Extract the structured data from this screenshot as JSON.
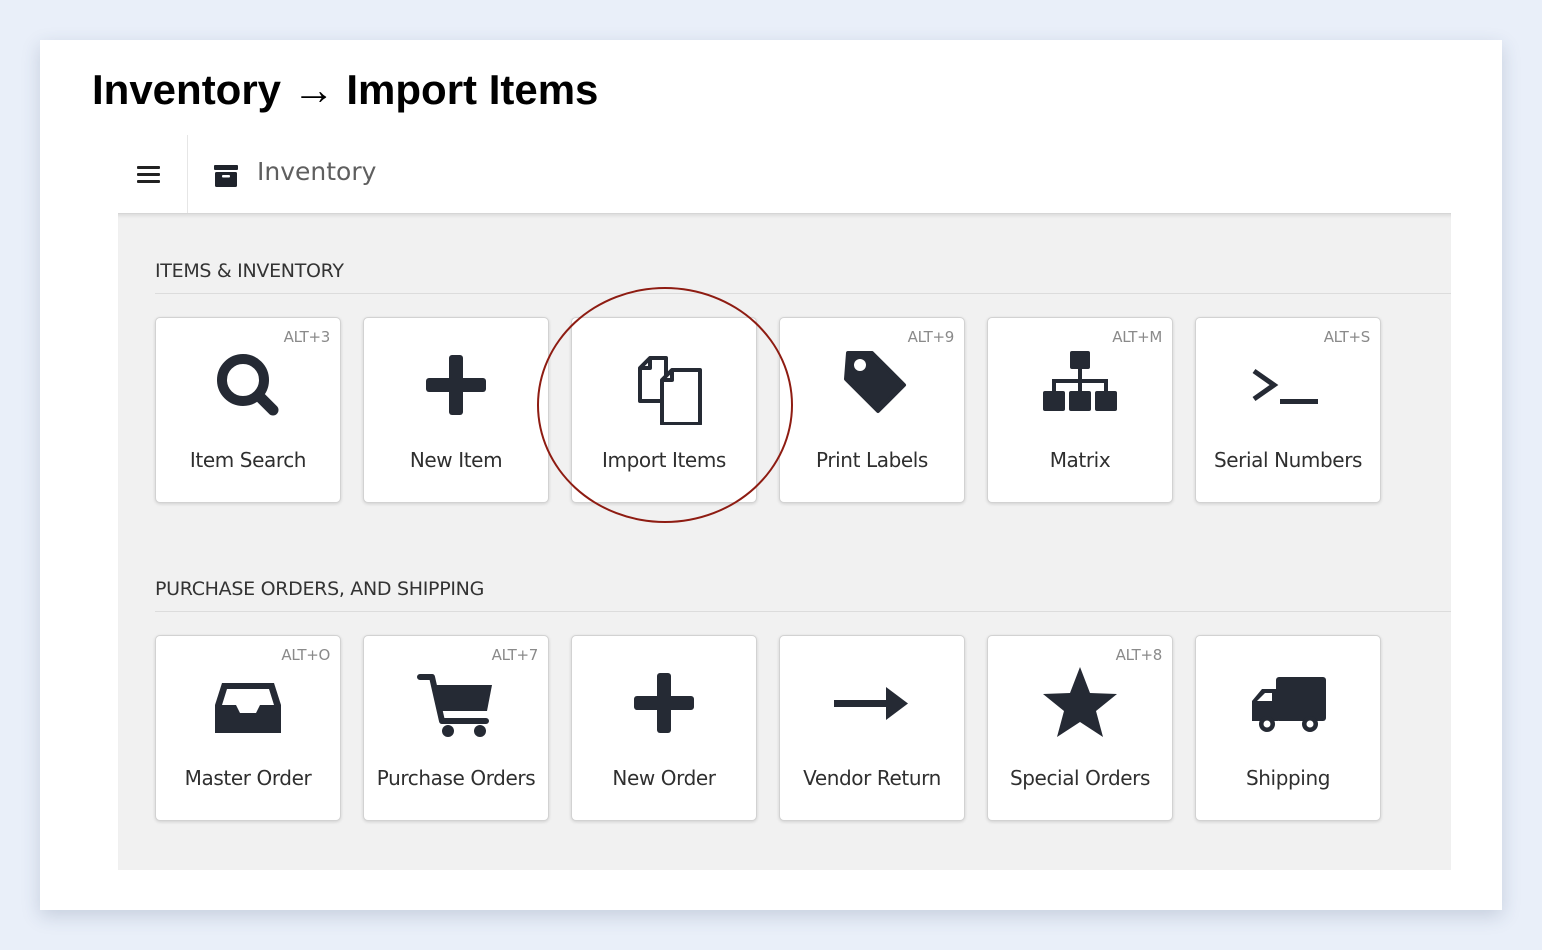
{
  "doc_title": "Inventory → Import Items",
  "app": {
    "title": "Inventory",
    "icon": "archive-icon",
    "menu_icon": "hamburger-menu-icon"
  },
  "sections": [
    {
      "title": "ITEMS & INVENTORY",
      "tiles": [
        {
          "label": "Item Search",
          "shortcut": "ALT+3",
          "icon": "search-icon"
        },
        {
          "label": "New Item",
          "shortcut": "",
          "icon": "plus-icon"
        },
        {
          "label": "Import Items",
          "shortcut": "",
          "icon": "copy-documents-icon",
          "highlighted": true
        },
        {
          "label": "Print Labels",
          "shortcut": "ALT+9",
          "icon": "tag-icon"
        },
        {
          "label": "Matrix",
          "shortcut": "ALT+M",
          "icon": "sitemap-icon"
        },
        {
          "label": "Serial Numbers",
          "shortcut": "ALT+S",
          "icon": "terminal-icon"
        }
      ]
    },
    {
      "title": "PURCHASE ORDERS, AND SHIPPING",
      "tiles": [
        {
          "label": "Master Order",
          "shortcut": "ALT+O",
          "icon": "inbox-icon"
        },
        {
          "label": "Purchase Orders",
          "shortcut": "ALT+7",
          "icon": "shopping-cart-icon"
        },
        {
          "label": "New Order",
          "shortcut": "",
          "icon": "plus-icon"
        },
        {
          "label": "Vendor Return",
          "shortcut": "",
          "icon": "arrow-right-icon"
        },
        {
          "label": "Special Orders",
          "shortcut": "ALT+8",
          "icon": "star-icon"
        },
        {
          "label": "Shipping",
          "shortcut": "",
          "icon": "truck-icon"
        }
      ]
    }
  ],
  "colors": {
    "icon": "#252a34",
    "highlight_circle": "#8e1c12",
    "page_background": "#e9eff9",
    "panel_background": "#f1f1f1"
  }
}
